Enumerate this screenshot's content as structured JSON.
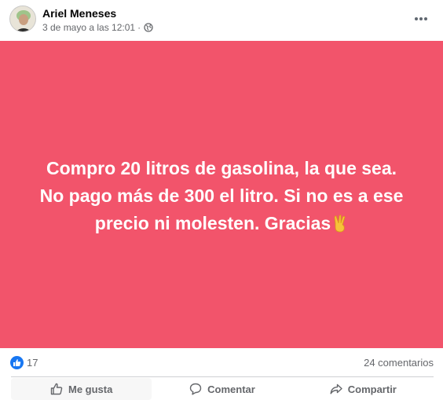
{
  "post": {
    "author": "Ariel Meneses",
    "timestamp": "3 de mayo a las 12:01",
    "separator": "·",
    "privacy_icon": "globe-icon",
    "more_icon": "more-options-icon",
    "text_line1": "Compro 20 litros de gasolina, la que sea.",
    "text_line2": "No pago más de 300 el litro. Si no es a ese",
    "text_line3": "precio ni molesten. Gracias",
    "emoji_icon": "victory-hand-icon",
    "background_color": "#f2546b"
  },
  "reactions": {
    "icon": "like-reaction-icon",
    "count": "17",
    "comments": "24 comentarios"
  },
  "actions": {
    "like_label": "Me gusta",
    "comment_label": "Comentar",
    "share_label": "Compartir"
  }
}
